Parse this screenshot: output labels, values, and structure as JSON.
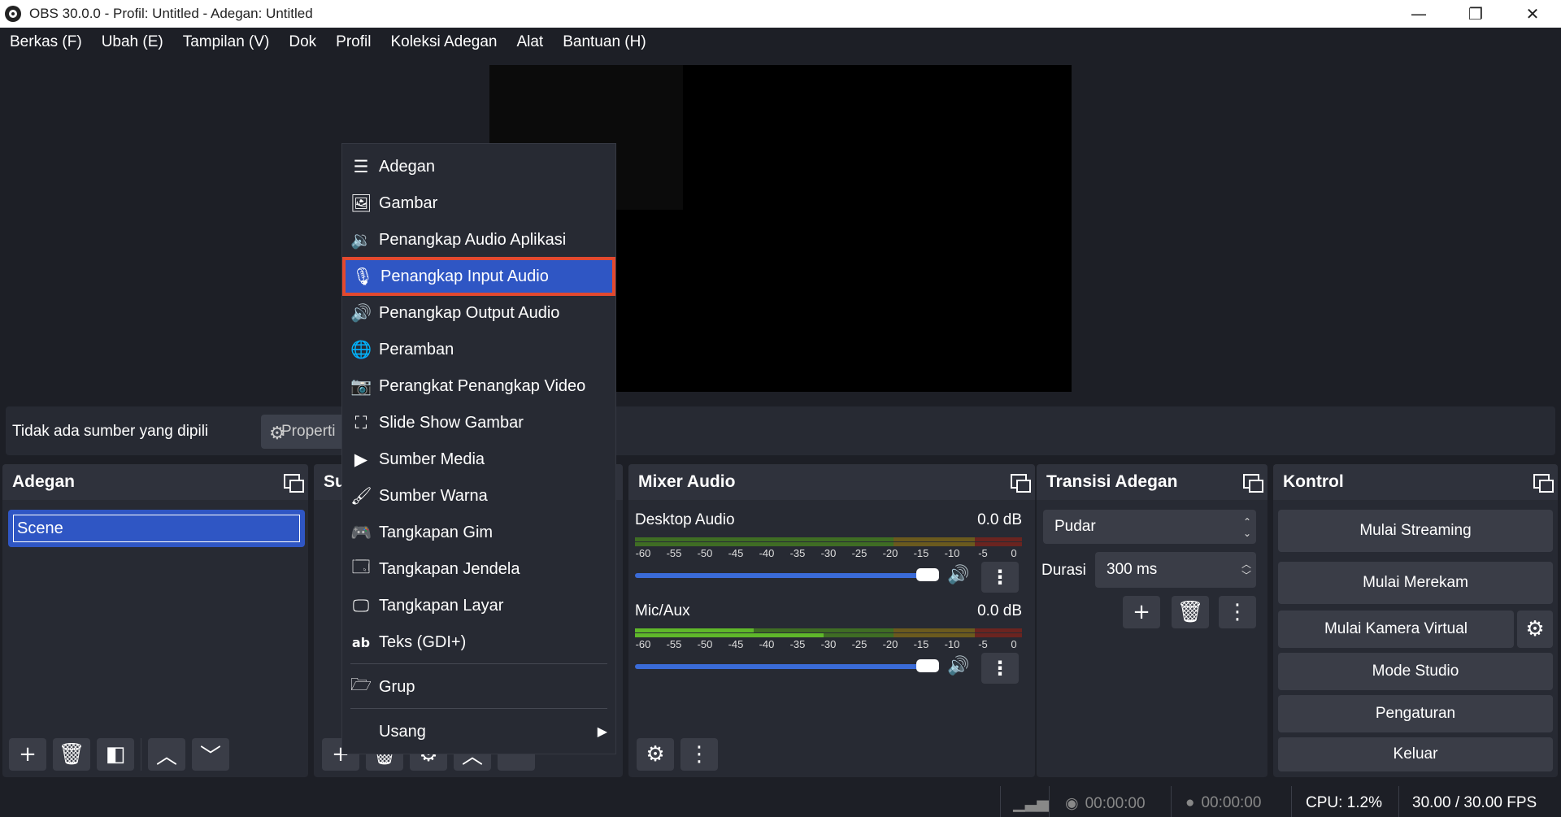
{
  "window": {
    "title": "OBS 30.0.0 - Profil: Untitled - Adegan: Untitled",
    "minimize": "—",
    "maximize": "❐",
    "close": "✕"
  },
  "menubar": [
    "Berkas (F)",
    "Ubah (E)",
    "Tampilan (V)",
    "Dok",
    "Profil",
    "Koleksi Adegan",
    "Alat",
    "Bantuan (H)"
  ],
  "context_bar": {
    "no_source": "Tidak ada sumber yang dipilih",
    "properties": "Properti"
  },
  "scenes_dock": {
    "title": "Adegan",
    "items": [
      "Scene"
    ]
  },
  "sources_dock": {
    "title": "Sumber"
  },
  "context_menu": {
    "items": [
      {
        "label": "Adegan",
        "icon": "list-icon"
      },
      {
        "label": "Gambar",
        "icon": "image-icon"
      },
      {
        "label": "Penangkap Audio Aplikasi",
        "icon": "app-audio-icon"
      },
      {
        "label": "Penangkap Input Audio",
        "icon": "microphone-icon",
        "selected": true
      },
      {
        "label": "Penangkap Output Audio",
        "icon": "speaker-icon"
      },
      {
        "label": "Peramban",
        "icon": "globe-icon"
      },
      {
        "label": "Perangkat Penangkap Video",
        "icon": "camera-icon"
      },
      {
        "label": "Slide Show Gambar",
        "icon": "slideshow-icon"
      },
      {
        "label": "Sumber Media",
        "icon": "play-icon"
      },
      {
        "label": "Sumber Warna",
        "icon": "brush-icon"
      },
      {
        "label": "Tangkapan Gim",
        "icon": "gamepad-icon"
      },
      {
        "label": "Tangkapan Jendela",
        "icon": "window-icon"
      },
      {
        "label": "Tangkapan Layar",
        "icon": "monitor-icon"
      },
      {
        "label": "Teks (GDI+)",
        "icon": "text-icon"
      }
    ],
    "group": "Grup",
    "deprecated": "Usang"
  },
  "mixer": {
    "title": "Mixer Audio",
    "ticks": [
      "-60",
      "-55",
      "-50",
      "-45",
      "-40",
      "-35",
      "-30",
      "-25",
      "-20",
      "-15",
      "-10",
      "-5",
      "0"
    ],
    "channels": [
      {
        "name": "Desktop Audio",
        "db": "0.0 dB",
        "volume": 1.0
      },
      {
        "name": "Mic/Aux",
        "db": "0.0 dB",
        "volume": 1.0
      }
    ]
  },
  "transitions": {
    "title": "Transisi Adegan",
    "selected": "Pudar",
    "duration_label": "Durasi",
    "duration_value": "300 ms"
  },
  "controls": {
    "title": "Kontrol",
    "start_streaming": "Mulai Streaming",
    "start_recording": "Mulai Merekam",
    "start_virtual_cam": "Mulai Kamera Virtual",
    "studio_mode": "Mode Studio",
    "settings": "Pengaturan",
    "exit": "Keluar"
  },
  "status": {
    "stream_time": "00:00:00",
    "record_time": "00:00:00",
    "cpu": "CPU: 1.2%",
    "fps": "30.00 / 30.00 FPS"
  },
  "colors": {
    "accent": "#2f56c4",
    "highlight_outline": "#e2492f",
    "meter_green": "#5fb82a",
    "meter_yellow": "#b89a2a",
    "meter_red": "#b8332a"
  }
}
